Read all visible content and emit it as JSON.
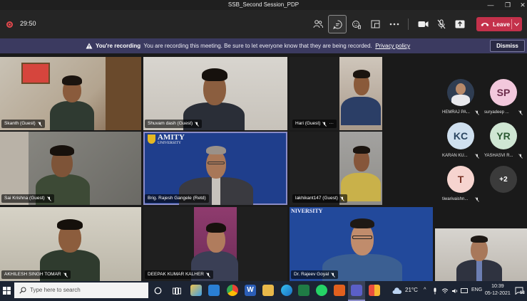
{
  "window": {
    "title": "SSB_Second Session_PDP",
    "minimize": "—",
    "maximize": "❐",
    "close": "✕"
  },
  "toolbar": {
    "timer": "29:50",
    "leave_label": "Leave"
  },
  "banner": {
    "heading": "You're recording",
    "message": "You are recording this meeting. Be sure to let everyone know that they are being recorded.",
    "link": "Privacy policy",
    "dismiss": "Dismiss"
  },
  "participants": [
    {
      "name": "Skanth (Guest)"
    },
    {
      "name": "Shuvam dash (Guest)"
    },
    {
      "name": "Hari (Guest)"
    },
    {
      "name": "Sai Krishna (Guest)"
    },
    {
      "name": "Brig. Rajesh Gangele (Retd)",
      "banner_text": "AMITY",
      "banner_sub": "UNIVERSITY"
    },
    {
      "name": "lakhikant147 (Guest)"
    },
    {
      "name": "AKHILESH SINGH TOMAR"
    },
    {
      "name": "DEEPAK KUMAR KALHER"
    },
    {
      "name": "Dr. Rajeev Goyal",
      "banner_text": "NIVERSITY"
    }
  ],
  "roster": [
    {
      "initials": "",
      "name": "HEMRAJ PA...",
      "color": "#2f3d52"
    },
    {
      "initials": "SP",
      "name": "suryadeep ...",
      "color": "#f2c8dc",
      "text_color": "#6b2c4a"
    },
    {
      "initials": "KC",
      "name": "KARAN KU...",
      "color": "#cfe0ef",
      "text_color": "#2a4560"
    },
    {
      "initials": "YR",
      "name": "YASHASVI R...",
      "color": "#cfe6d3",
      "text_color": "#2c5a33"
    },
    {
      "initials": "T",
      "name": "tiwarivaishn...",
      "color": "#f6d4cf",
      "text_color": "#7a3326"
    },
    {
      "initials": "+2",
      "name": "",
      "color": "#3b3b3b",
      "text_color": "#ffffff"
    }
  ],
  "taskbar": {
    "search_placeholder": "Type here to search",
    "weather": "21°C",
    "language": "ENG",
    "time": "10:39",
    "date": "05-12-2021",
    "notifications": "18"
  }
}
